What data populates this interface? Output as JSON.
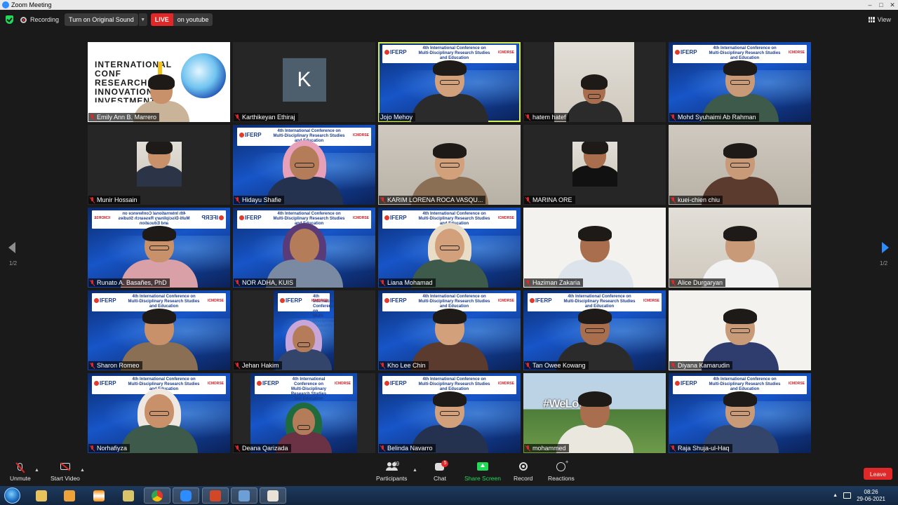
{
  "window": {
    "title": "Zoom Meeting"
  },
  "topbar": {
    "recording_label": "Recording",
    "sound_button": "Turn on Original Sound",
    "live_badge": "LIVE",
    "live_target": "on youtube",
    "view_label": "View"
  },
  "conference_banner": {
    "logo": "IFERP",
    "title": "4th International Conference on",
    "subtitle": "Multi-Disciplinary Research Studies and Education",
    "badge": "ICMDRSE"
  },
  "emily_background": {
    "text": "INTERNATIONAL CONF RESEARCH INNOVATION INVESTMENT"
  },
  "participants": [
    {
      "name": "Emily Ann B. Marrero",
      "bg": "emily",
      "muted": true
    },
    {
      "name": "Karthikeyan Ethiraj",
      "bg": "avatar",
      "initial": "K",
      "muted": true
    },
    {
      "name": "Jojo Mehoy",
      "bg": "conf",
      "muted": false,
      "active": true
    },
    {
      "name": "hatem hatef",
      "bg": "office-card",
      "muted": true
    },
    {
      "name": "Mohd Syuhaimi Ab Rahman",
      "bg": "conf",
      "muted": true
    },
    {
      "name": "Munir Hossain",
      "bg": "photo-card",
      "muted": true
    },
    {
      "name": "Hidayu Shafie",
      "bg": "conf",
      "muted": true
    },
    {
      "name": "KARIM LORENA ROCA VASQU...",
      "bg": "room",
      "muted": true
    },
    {
      "name": "MARINA ORE",
      "bg": "photo-card",
      "muted": true
    },
    {
      "name": "kuei-chien chiu",
      "bg": "room",
      "muted": true
    },
    {
      "name": "Runato A. Basañes, PhD",
      "bg": "conf-flip",
      "muted": true
    },
    {
      "name": "NOR ADHA, KUIS",
      "bg": "conf",
      "muted": true
    },
    {
      "name": "Liana Mohamad",
      "bg": "conf",
      "muted": true
    },
    {
      "name": "Haziman Zakaria",
      "bg": "white",
      "muted": true
    },
    {
      "name": "Alice Durgaryan",
      "bg": "office",
      "muted": true
    },
    {
      "name": "Sharon Romeo",
      "bg": "conf",
      "muted": true
    },
    {
      "name": "Jehan Hakim",
      "bg": "conf-narrow",
      "muted": true
    },
    {
      "name": "Kho Lee Chin",
      "bg": "conf",
      "muted": true
    },
    {
      "name": "Tan Owee Kowang",
      "bg": "conf",
      "muted": true
    },
    {
      "name": "Diyana Kamarudin",
      "bg": "white",
      "muted": true
    },
    {
      "name": "Norhafiyza",
      "bg": "conf",
      "muted": true
    },
    {
      "name": "Deana Qarizada",
      "bg": "conf-narrow",
      "muted": true
    },
    {
      "name": "Belinda Navarro",
      "bg": "conf",
      "muted": true
    },
    {
      "name": "mohammed",
      "bg": "outdoor",
      "sign": "#WeLovePM",
      "muted": true
    },
    {
      "name": "Raja Shuja-ul-Haq",
      "bg": "conf",
      "muted": true
    }
  ],
  "paging": {
    "left": "1/2",
    "right": "1/2"
  },
  "toolbar": {
    "unmute": "Unmute",
    "start_video": "Start Video",
    "participants": "Participants",
    "participant_count": "49",
    "chat": "Chat",
    "chat_badge": "5",
    "share_screen": "Share Screen",
    "record": "Record",
    "reactions": "Reactions",
    "leave": "Leave"
  },
  "taskbar": {
    "time": "08:26",
    "date": "29-06-2021"
  },
  "colors": {
    "accent": "#2d8cff",
    "live": "#e02828",
    "share": "#23d959",
    "active_speaker": "#d6ee52"
  }
}
